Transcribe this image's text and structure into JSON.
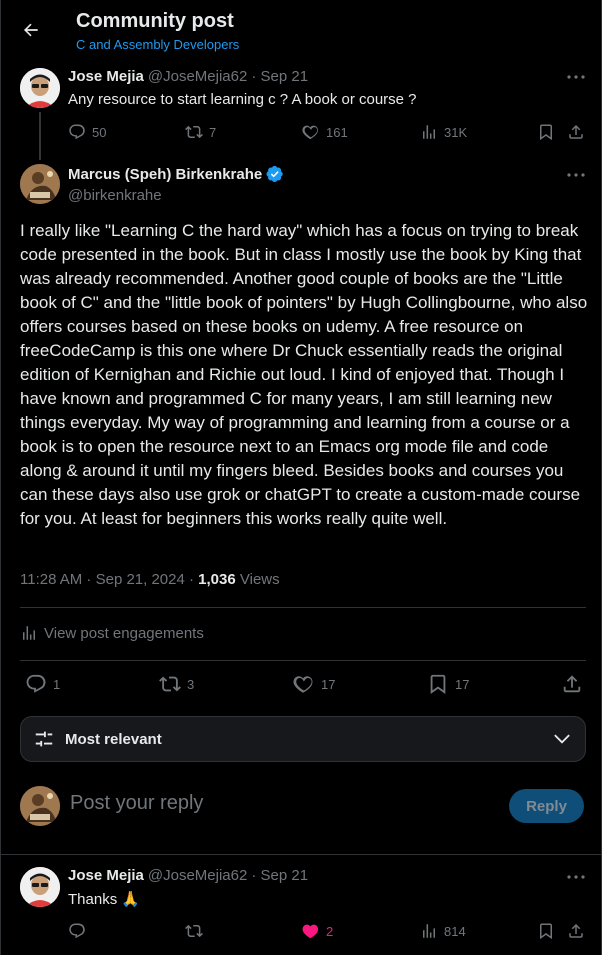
{
  "header": {
    "title": "Community post",
    "community": "C and Assembly Developers"
  },
  "post1": {
    "name": "Jose Mejia",
    "handle": "@JoseMejia62",
    "date": "· Sep 21",
    "text": "Any resource to start learning c ? A book or course ?",
    "replies": "50",
    "reposts": "7",
    "likes": "161",
    "views": "31K"
  },
  "main": {
    "name": "Marcus (Speh) Birkenkrahe",
    "handle": "@birkenkrahe",
    "text": "I really like \"Learning C the hard way\" which has a focus on trying to break code presented in the book. But in class I mostly use the book by King that was already recommended. Another good couple of books are the \"Little book of C\" and the \"little book of pointers\" by Hugh Collingbourne, who also offers courses based on these books on udemy. A free resource on freeCodeCamp is this one where Dr Chuck essentially reads the original edition of Kernighan and Richie out loud. I kind of enjoyed that. Though I have known and programmed C for many years, I am still learning new things everyday. My way of programming and learning from a course or a book is to open the resource next to an Emacs org mode file and code along & around it until my fingers bleed. Besides books and courses you can these days also use grok or chatGPT to create a custom-made course for you. At least for beginners this works really quite well.",
    "time": "11:28 AM · Sep 21, 2024 · ",
    "views_count": "1,036",
    "views_label": " Views",
    "engagements": "View post engagements",
    "replies": "1",
    "reposts": "3",
    "likes": "17",
    "bookmarks": "17"
  },
  "sort": {
    "label": "Most relevant"
  },
  "compose": {
    "placeholder": "Post your reply",
    "button": "Reply"
  },
  "reply1": {
    "name": "Jose Mejia",
    "handle": "@JoseMejia62",
    "date": "· Sep 21",
    "text": "Thanks 🙏",
    "likes": "2",
    "views": "814"
  },
  "colors": {
    "accent": "#1d9bf0",
    "liked": "#f91880",
    "muted": "#71767b",
    "verified": "#1d9bf0"
  }
}
